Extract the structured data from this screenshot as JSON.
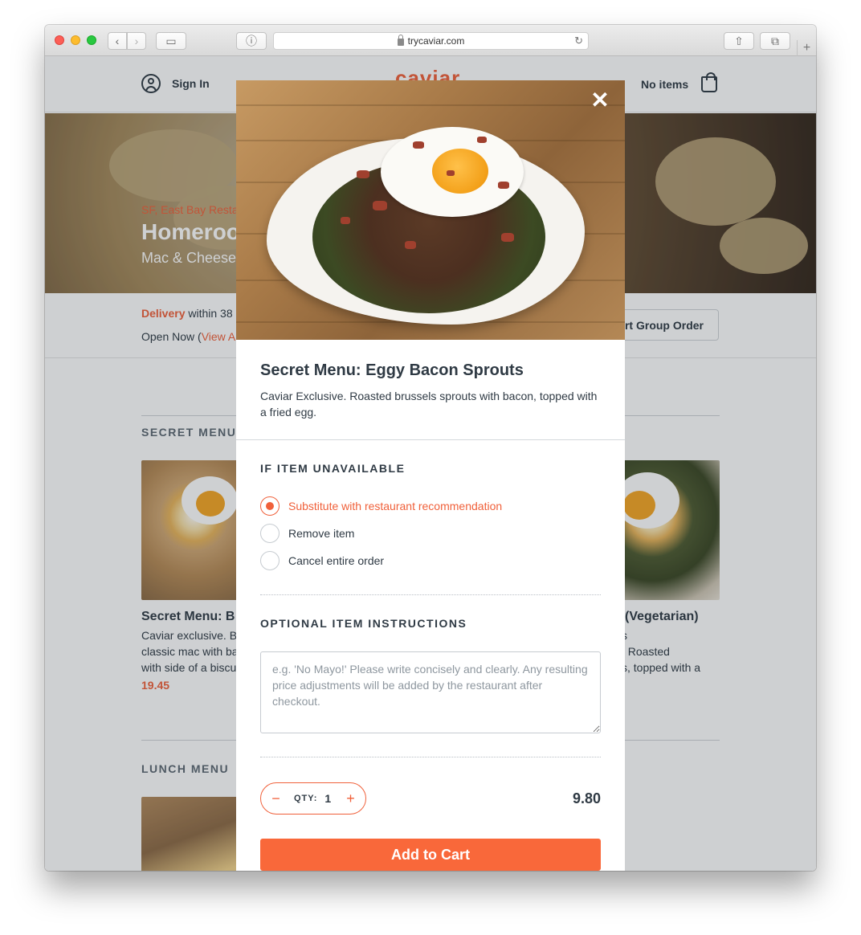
{
  "browser": {
    "url": "trycaviar.com"
  },
  "header": {
    "sign_in": "Sign In",
    "logo": "caviar",
    "cart": "No items"
  },
  "hero": {
    "tag": "SF, East Bay Resta",
    "title": "Homeroo",
    "subtitle": "Mac & Cheese"
  },
  "info": {
    "delivery_label": "Delivery",
    "delivery_text": " within 38",
    "open_text": "Open Now (",
    "open_link": "View A",
    "group_order": "rt Group Order"
  },
  "sections": {
    "secret_menu": "SECRET MENU",
    "lunch_menu": "LUNCH MENU"
  },
  "cards": [
    {
      "title": "Secret Menu: B",
      "desc_lines": [
        "Caviar exclusive. B",
        "classic mac with ba",
        "with side of a biscu"
      ],
      "price": "19.45"
    },
    {
      "title": " (Vegetarian)",
      "desc_lines": [
        "s",
        ". Roasted",
        "s, topped with a"
      ]
    }
  ],
  "modal": {
    "title": "Secret Menu: Eggy Bacon Sprouts",
    "description": "Caviar Exclusive. Roasted brussels sprouts with bacon, topped with a fried egg.",
    "unavailable_heading": "IF ITEM UNAVAILABLE",
    "options": [
      {
        "label": "Substitute with restaurant recommendation",
        "selected": true
      },
      {
        "label": "Remove item",
        "selected": false
      },
      {
        "label": "Cancel entire order",
        "selected": false
      }
    ],
    "instructions_heading": "OPTIONAL ITEM INSTRUCTIONS",
    "instructions_placeholder": "e.g. 'No Mayo!' Please write concisely and clearly. Any resulting price adjustments will be added by the restaurant after checkout.",
    "qty_label": "QTY:",
    "qty_value": "1",
    "qty_minus": "−",
    "qty_plus": "+",
    "price": "9.80",
    "add_button": "Add to Cart",
    "close_symbol": "✕"
  },
  "colors": {
    "accent": "#f0603a",
    "button": "#f9683a",
    "text": "#2f3a44"
  }
}
